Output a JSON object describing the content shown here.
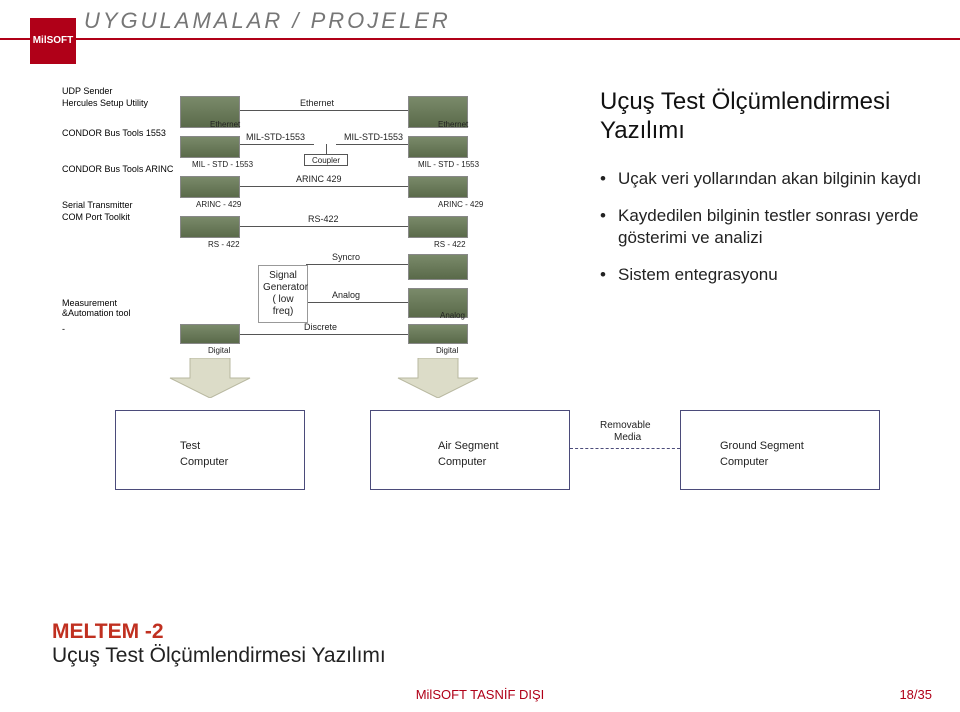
{
  "header": {
    "title": "UYGULAMALAR / PROJELER",
    "logo_text": "MilSOFT"
  },
  "tools": {
    "udp": "UDP Sender",
    "hercules": "Hercules Setup Utility",
    "condor1553": "CONDOR Bus Tools 1553",
    "condorArinc": "CONDOR Bus Tools ARINC",
    "serial": "Serial Transmitter",
    "comport": "COM Port Toolkit",
    "measurement": "Measurement &Automation tool",
    "dash": "-"
  },
  "card_labels": {
    "ethernetL": "Ethernet",
    "milL": "MIL - STD - 1553",
    "arincL": "ARINC  - 429",
    "rsL": "RS - 422",
    "digitalL": "Digital",
    "ethernetR": "Ethernet",
    "milR": "MIL - STD - 1553",
    "arincR": "ARINC - 429",
    "rsR": "RS - 422",
    "digitalR": "Digital",
    "analogR": "Analog"
  },
  "links": {
    "ethernet": "Ethernet",
    "mil1": "MIL-STD-1553",
    "mil2": "MIL-STD-1553",
    "coupler": "Coupler",
    "arinc": "ARINC 429",
    "rs": "RS-422",
    "syncro": "Syncro",
    "analog": "Analog",
    "discrete": "Discrete"
  },
  "siggen": {
    "l1": "Signal",
    "l2": "Generator",
    "l3": "( low freq)"
  },
  "segments": {
    "test": "Test",
    "computer": "Computer",
    "air": "Air Segment",
    "ground": "Ground Segment",
    "removable": "Removable",
    "media": "Media"
  },
  "right_panel": {
    "title": "Uçuş Test Ölçümlendirmesi Yazılımı",
    "b1": "Uçak veri yollarından akan bilginin kaydı",
    "b2": "Kaydedilen bilginin testler sonrası yerde gösterimi ve analizi",
    "b3": "Sistem entegrasyonu"
  },
  "bottom": {
    "t1": "MELTEM -2",
    "t2": "Uçuş Test Ölçümlendirmesi Yazılımı"
  },
  "footer": {
    "mid": "MilSOFT TASNİF DIŞI",
    "right": "18/35"
  }
}
